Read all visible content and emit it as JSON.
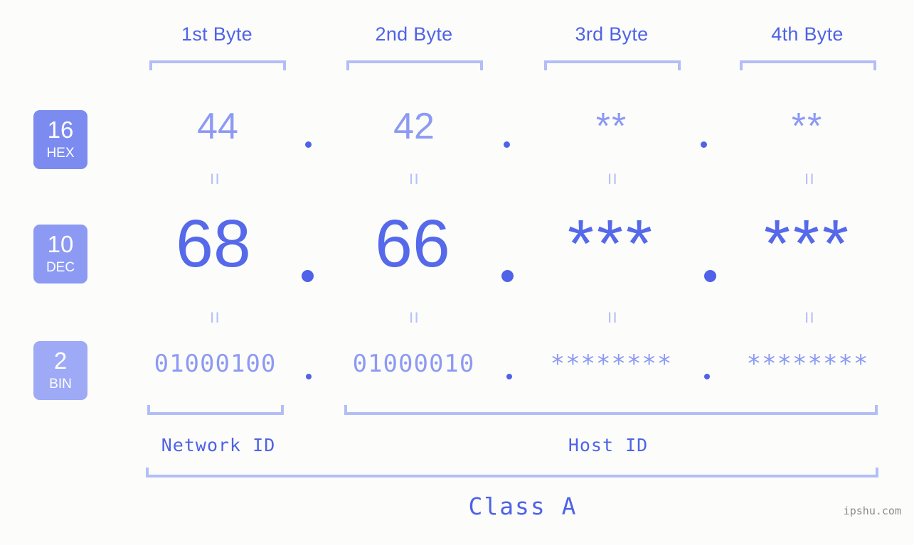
{
  "watermark": "ipshu.com",
  "byte_headers": [
    {
      "label": "1st Byte"
    },
    {
      "label": "2nd Byte"
    },
    {
      "label": "3rd Byte"
    },
    {
      "label": "4th Byte"
    }
  ],
  "bases": [
    {
      "num": "16",
      "name": "HEX"
    },
    {
      "num": "10",
      "name": "DEC"
    },
    {
      "num": "2",
      "name": "BIN"
    }
  ],
  "rows": {
    "hex": {
      "octets": [
        "44",
        "42",
        "**",
        "**"
      ]
    },
    "dec": {
      "octets": [
        "68",
        "66",
        "***",
        "***"
      ]
    },
    "bin": {
      "octets": [
        "01000100",
        "01000010",
        "********",
        "********"
      ]
    }
  },
  "separators": {
    "dot": ".",
    "equals": "="
  },
  "id_labels": [
    {
      "label": "Network ID"
    },
    {
      "label": "Host ID"
    }
  ],
  "class_label": "Class A",
  "colors": {
    "background": "#fcfdfa",
    "accent_strong": "#4f62e8",
    "accent_dec": "#5569ea",
    "accent_mid": "#8d9af3",
    "accent_light": "#b3bdf7",
    "badge_hex": "#7c8bf0",
    "badge_dec": "#8d9af3",
    "badge_bin": "#9eaaf6",
    "watermark": "#8a8a8a"
  }
}
